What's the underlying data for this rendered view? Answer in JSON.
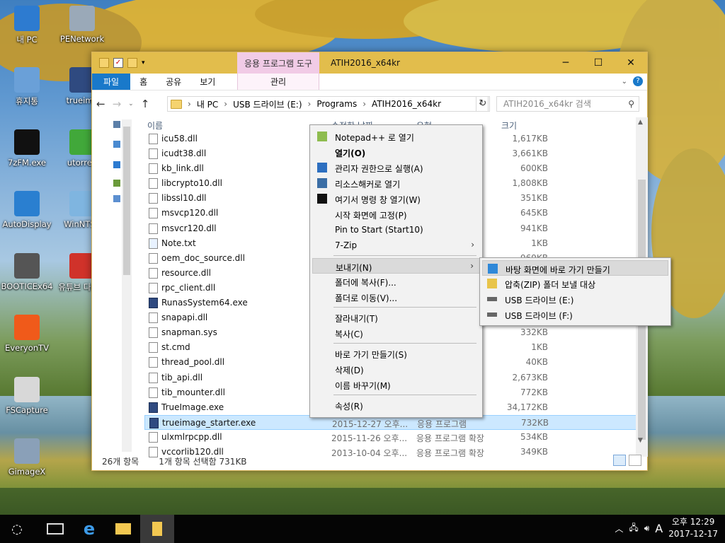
{
  "desktop": {
    "icons": [
      {
        "label": "내 PC",
        "icon": "pc-icon",
        "color": "#2d7bd0"
      },
      {
        "label": "PENetwork",
        "icon": "network-icon",
        "color": "#9aa9b8"
      },
      {
        "label": "휴지통",
        "icon": "recycle-bin-icon",
        "color": "#6aa0d8"
      },
      {
        "label": "trueima",
        "icon": "trueimage-icon",
        "color": "#2f4a80"
      },
      {
        "label": "7zFM.exe",
        "icon": "7zip-icon",
        "color": "#111111"
      },
      {
        "label": "utorren",
        "icon": "utorrent-icon",
        "color": "#41a83a"
      },
      {
        "label": "AutoDisplay",
        "icon": "display-icon",
        "color": "#2a7fd0"
      },
      {
        "label": "WinNTSe",
        "icon": "winntsetup-icon",
        "color": "#7fb5e0"
      },
      {
        "label": "BOOTICEx64",
        "icon": "bootice-icon",
        "color": "#555555"
      },
      {
        "label": "유튜브 다운로",
        "icon": "youtube-downloader-icon",
        "color": "#d0322a"
      },
      {
        "label": "EveryonTV",
        "icon": "everyontv-icon",
        "color": "#f05a1a"
      },
      {
        "label": "FSCapture",
        "icon": "fscapture-icon",
        "color": "#d8d8d8"
      },
      {
        "label": "GimageX",
        "icon": "gimagex-icon",
        "color": "#8aa0b8"
      }
    ]
  },
  "window": {
    "title": "ATIH2016_x64kr",
    "context_tab": "응용 프로그램 도구",
    "ribbon_tabs": [
      "파일",
      "홈",
      "공유",
      "보기"
    ],
    "context_ribbon_tab": "관리",
    "controls": [
      "─",
      "☐",
      "✕"
    ],
    "accent_color": "#e2bd4c"
  },
  "nav": {
    "back": "←",
    "forward": "→",
    "up": "↑",
    "breadcrumb": [
      "내 PC",
      "USB 드라이브 (E:)",
      "Programs",
      "ATIH2016_x64kr"
    ],
    "search_placeholder": "ATIH2016_x64kr 검색"
  },
  "columns": {
    "name": "이름",
    "date": "수정한 날짜",
    "type": "유형",
    "size": "크기"
  },
  "files": [
    {
      "name": "icu58.dll",
      "date": "",
      "type": "",
      "size": "1,617KB",
      "icon": "file"
    },
    {
      "name": "icudt38.dll",
      "date": "",
      "type": "장",
      "size": "3,661KB",
      "icon": "file"
    },
    {
      "name": "kb_link.dll",
      "date": "",
      "type": "장",
      "size": "600KB",
      "icon": "file"
    },
    {
      "name": "libcrypto10.dll",
      "date": "",
      "type": "장",
      "size": "1,808KB",
      "icon": "file"
    },
    {
      "name": "libssl10.dll",
      "date": "",
      "type": "장",
      "size": "351KB",
      "icon": "file"
    },
    {
      "name": "msvcp120.dll",
      "date": "",
      "type": "장",
      "size": "645KB",
      "icon": "file"
    },
    {
      "name": "msvcr120.dll",
      "date": "",
      "type": "장",
      "size": "941KB",
      "icon": "file"
    },
    {
      "name": "Note.txt",
      "date": "",
      "type": "",
      "size": "1KB",
      "icon": "txt"
    },
    {
      "name": "oem_doc_source.dll",
      "date": "",
      "type": "장",
      "size": "969KB",
      "icon": "file"
    },
    {
      "name": "resource.dll",
      "date": "",
      "type": "",
      "size": "",
      "icon": "file"
    },
    {
      "name": "rpc_client.dll",
      "date": "",
      "type": "",
      "size": "",
      "icon": "file"
    },
    {
      "name": "RunasSystem64.exe",
      "date": "",
      "type": "",
      "size": "",
      "icon": "app"
    },
    {
      "name": "snapapi.dll",
      "date": "",
      "type": "",
      "size": "",
      "icon": "file"
    },
    {
      "name": "snapman.sys",
      "date": "",
      "type": "",
      "size": "332KB",
      "icon": "file"
    },
    {
      "name": "st.cmd",
      "date": "",
      "type": "",
      "size": "1KB",
      "icon": "file"
    },
    {
      "name": "thread_pool.dll",
      "date": "",
      "type": "장",
      "size": "40KB",
      "icon": "file"
    },
    {
      "name": "tib_api.dll",
      "date": "",
      "type": "장",
      "size": "2,673KB",
      "icon": "file"
    },
    {
      "name": "tib_mounter.dll",
      "date": "",
      "type": "장",
      "size": "772KB",
      "icon": "file"
    },
    {
      "name": "TrueImage.exe",
      "date": "",
      "type": "",
      "size": "34,172KB",
      "icon": "app"
    },
    {
      "name": "trueimage_starter.exe",
      "date": "2015-12-27 오후...",
      "type": "응용 프로그램",
      "size": "732KB",
      "icon": "app",
      "selected": true
    },
    {
      "name": "ulxmlrpcpp.dll",
      "date": "2015-11-26 오후...",
      "type": "응용 프로그램 확장",
      "size": "534KB",
      "icon": "file"
    },
    {
      "name": "vccorlib120.dll",
      "date": "2013-10-04 오후...",
      "type": "응용 프로그램 확장",
      "size": "349KB",
      "icon": "file"
    }
  ],
  "status": {
    "count": "26개 항목",
    "selection": "1개 항목 선택함 731KB"
  },
  "context_menu": [
    {
      "label": "Notepad++ 로 열기",
      "icon": "notepadpp-icon"
    },
    {
      "label": "열기(O)",
      "bold": true
    },
    {
      "label": "관리자 권한으로 실행(A)",
      "icon": "shield-icon"
    },
    {
      "label": "리소스해커로 열기",
      "icon": "resource-hacker-icon"
    },
    {
      "label": "여기서 명령 창 열기(W)",
      "icon": "cmd-icon"
    },
    {
      "label": "시작 화면에 고정(P)"
    },
    {
      "label": "Pin to Start (Start10)"
    },
    {
      "label": "7-Zip",
      "submenu": true
    },
    {
      "sep": true
    },
    {
      "label": "보내기(N)",
      "submenu": true,
      "highlighted": true
    },
    {
      "label": "폴더에 복사(F)..."
    },
    {
      "label": "폴더로 이동(V)..."
    },
    {
      "sep": true
    },
    {
      "label": "잘라내기(T)"
    },
    {
      "label": "복사(C)"
    },
    {
      "sep": true
    },
    {
      "label": "바로 가기 만들기(S)"
    },
    {
      "label": "삭제(D)"
    },
    {
      "label": "이름 바꾸기(M)"
    },
    {
      "sep": true
    },
    {
      "label": "속성(R)"
    }
  ],
  "sendto_menu": [
    {
      "label": "바탕 화면에 바로 가기 만들기",
      "icon": "desktop-icon",
      "highlighted": true
    },
    {
      "label": "압축(ZIP) 폴더 보낼 대상",
      "icon": "zip-folder-icon"
    },
    {
      "label": "USB 드라이브 (E:)",
      "icon": "usb-drive-icon"
    },
    {
      "label": "USB 드라이브 (F:)",
      "icon": "usb-drive-icon"
    }
  ],
  "taskbar": {
    "time": "오후 12:29",
    "date": "2017-12-17",
    "ime": "A",
    "tray_icons": [
      "chevron-up-icon",
      "network-icon",
      "volume-icon"
    ]
  }
}
